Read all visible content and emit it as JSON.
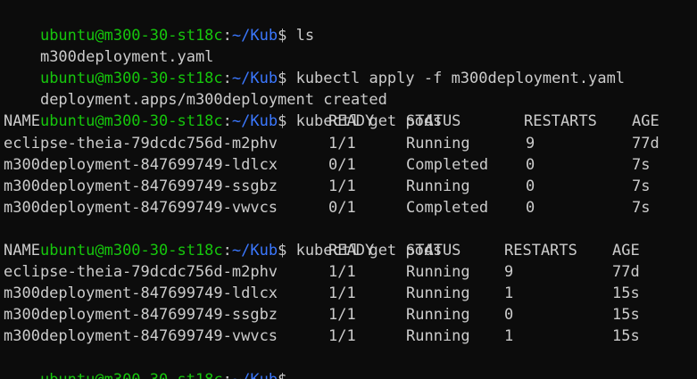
{
  "prompt": {
    "user_host": "ubuntu@m300-30-st18c",
    "colon": ":",
    "path": "~/Kub",
    "dollar": "$"
  },
  "commands": {
    "ls": " ls",
    "apply": " kubectl apply -f m300deployment.yaml",
    "get_pods_1": " kubectl get pods",
    "get_pods_2": " kubectl get pods",
    "last": ""
  },
  "outputs": {
    "ls_result": "m300deployment.yaml",
    "apply_result": "deployment.apps/m300deployment created"
  },
  "table1": {
    "headers": {
      "name": "NAME",
      "ready": "READY",
      "status": "STATUS",
      "restarts": "RESTARTS",
      "age": "AGE"
    },
    "rows": [
      {
        "name": "eclipse-theia-79dcdc756d-m2phv",
        "ready": "1/1",
        "status": "Running",
        "restarts": "9",
        "age": "77d"
      },
      {
        "name": "m300deployment-847699749-ldlcx",
        "ready": "0/1",
        "status": "Completed",
        "restarts": "0",
        "age": "7s"
      },
      {
        "name": "m300deployment-847699749-ssgbz",
        "ready": "1/1",
        "status": "Running",
        "restarts": "0",
        "age": "7s"
      },
      {
        "name": "m300deployment-847699749-vwvcs",
        "ready": "0/1",
        "status": "Completed",
        "restarts": "0",
        "age": "7s"
      }
    ]
  },
  "table2": {
    "headers": {
      "name": "NAME",
      "ready": "READY",
      "status": "STATUS",
      "restarts": "RESTARTS",
      "age": "AGE"
    },
    "rows": [
      {
        "name": "eclipse-theia-79dcdc756d-m2phv",
        "ready": "1/1",
        "status": "Running",
        "restarts": "9",
        "age": "77d"
      },
      {
        "name": "m300deployment-847699749-ldlcx",
        "ready": "1/1",
        "status": "Running",
        "restarts": "1",
        "age": "15s"
      },
      {
        "name": "m300deployment-847699749-ssgbz",
        "ready": "1/1",
        "status": "Running",
        "restarts": "0",
        "age": "15s"
      },
      {
        "name": "m300deployment-847699749-vwvcs",
        "ready": "1/1",
        "status": "Running",
        "restarts": "1",
        "age": "15s"
      }
    ]
  },
  "colors": {
    "background": "#0c0c0c",
    "foreground": "#cccccc",
    "user_host": "#16c60c",
    "path": "#3b78ff"
  }
}
